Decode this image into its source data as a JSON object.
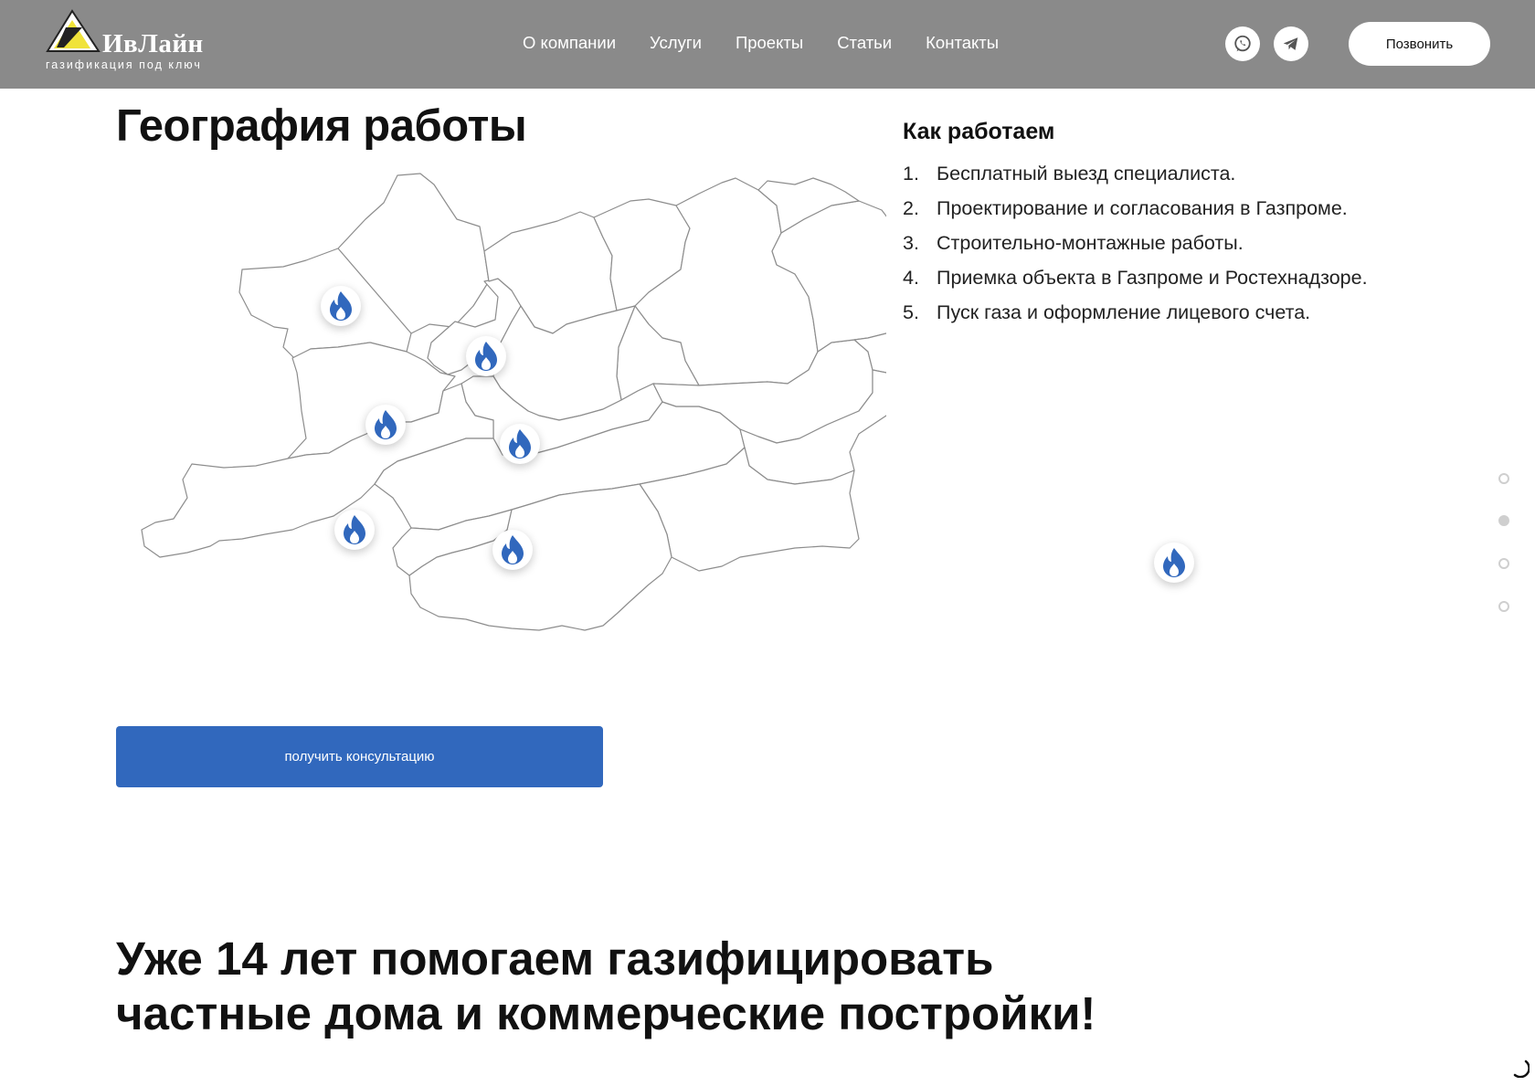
{
  "header": {
    "logo": {
      "name": "ИвЛайн",
      "tagline": "газификация под ключ"
    },
    "nav": [
      "О компании",
      "Услуги",
      "Проекты",
      "Статьи",
      "Контакты"
    ],
    "social": [
      "whatsapp-icon",
      "telegram-icon"
    ],
    "call_label": "Позвонить"
  },
  "geography": {
    "title": "География работы",
    "pins_count": 7,
    "cta_label": "получить консультацию"
  },
  "how_we_work": {
    "title": "Как работаем",
    "steps": [
      {
        "num": "1.",
        "text": "Бесплатный выезд специалиста."
      },
      {
        "num": "2.",
        "text": "Проектирование и согласования в Газпроме."
      },
      {
        "num": "3.",
        "text": "Строительно-монтажные работы."
      },
      {
        "num": "4.",
        "text": "Приемка объекта в Газпроме и Ростехнадзоре."
      },
      {
        "num": "5.",
        "text": "Пуск газа и оформление лицевого счета."
      }
    ]
  },
  "side_nav": {
    "count": 4,
    "active_index": 1
  },
  "banner": {
    "line1": "Уже 14 лет помогаем газифицировать",
    "line2": "частные дома и коммерческие постройки!"
  },
  "colors": {
    "header_bg": "#8a8a8a",
    "accent_blue": "#3168bd",
    "logo_yellow": "#f0e33a"
  }
}
